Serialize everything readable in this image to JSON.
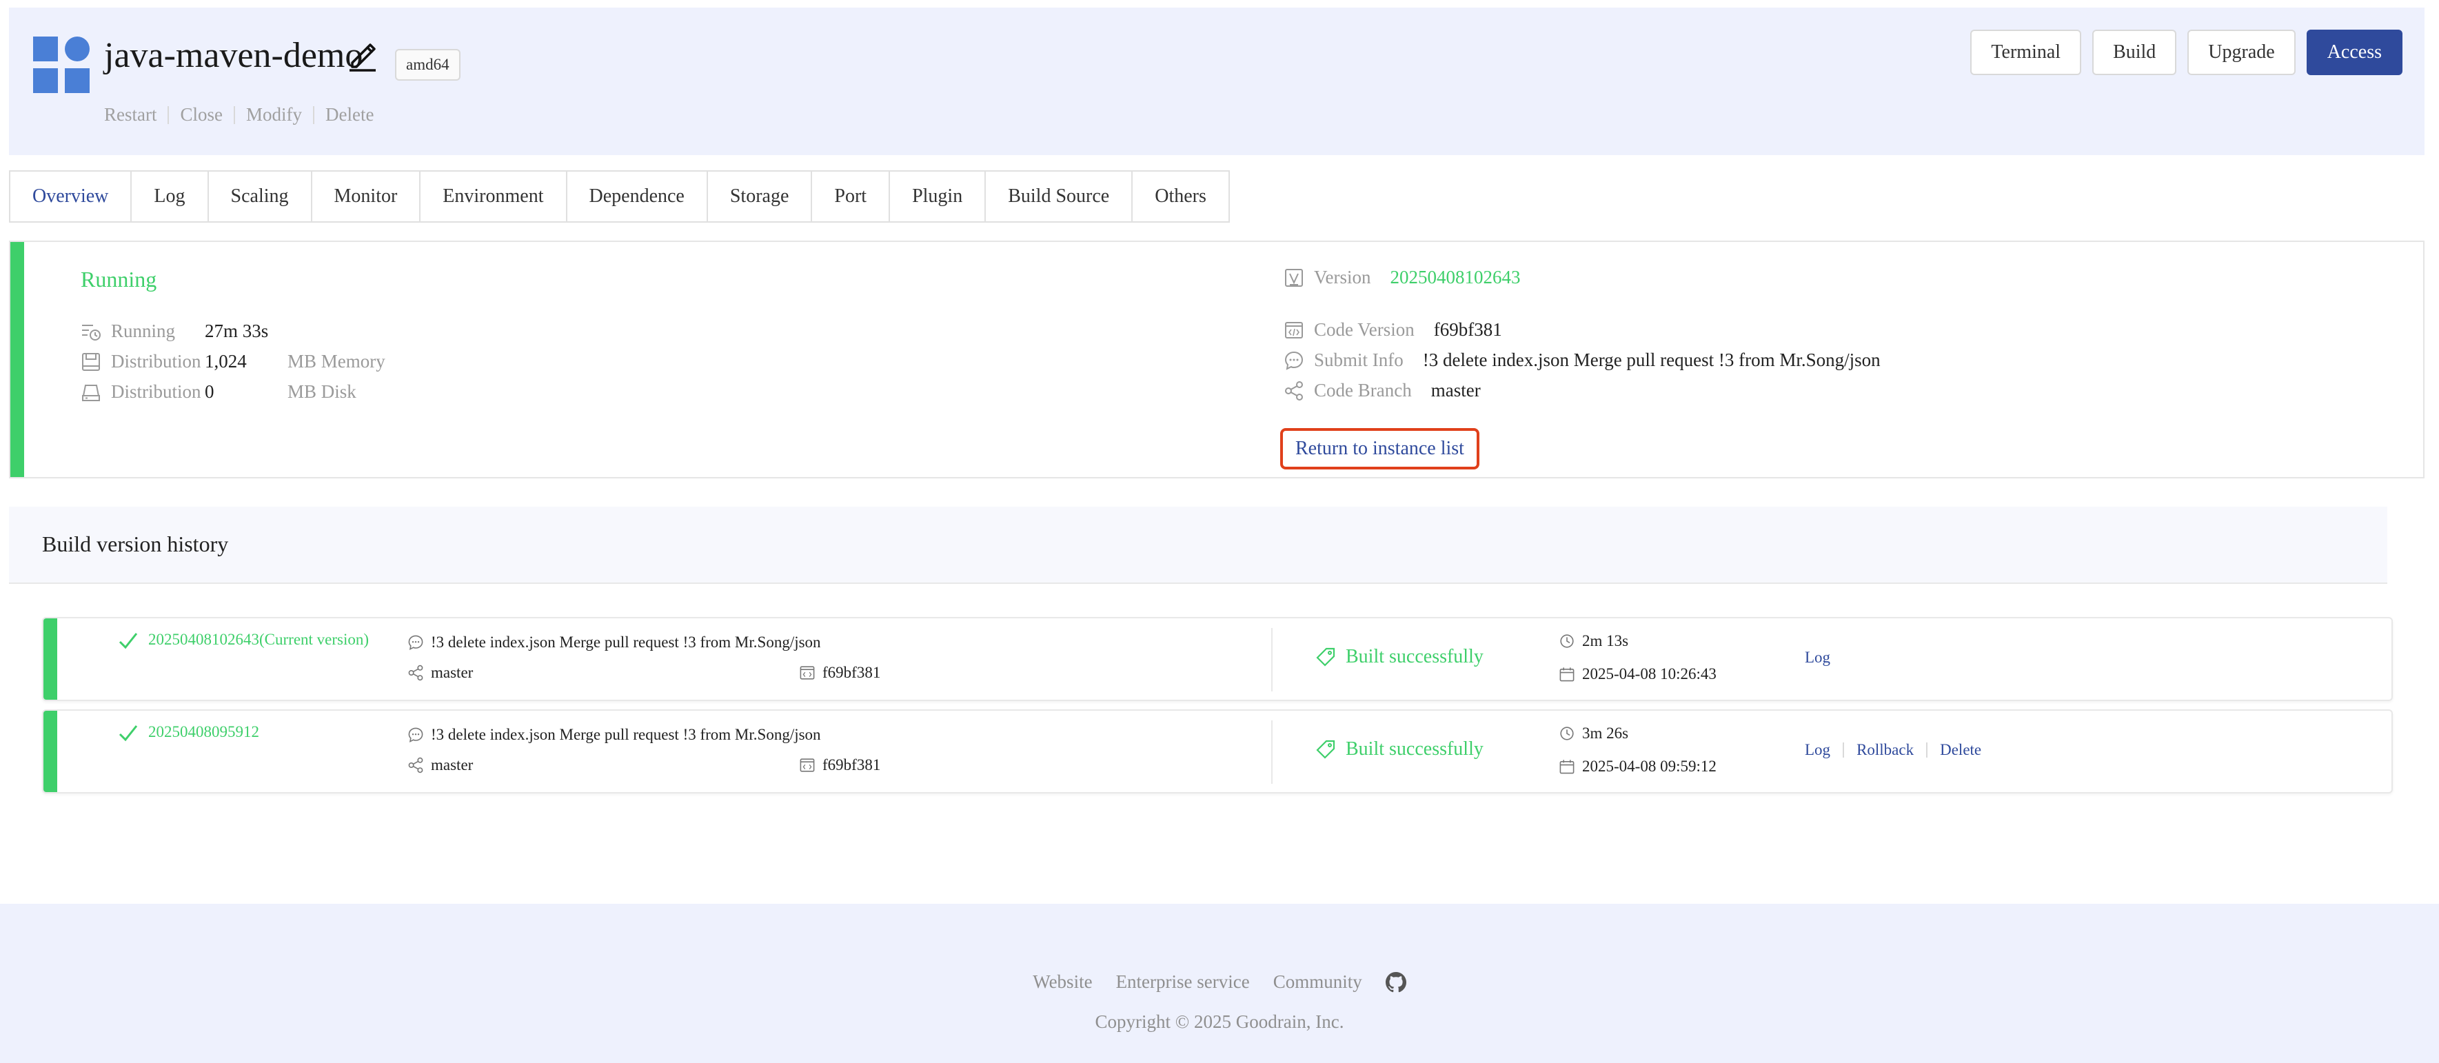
{
  "header": {
    "app_name": "java-maven-demo",
    "arch_badge": "amd64",
    "actions": [
      "Restart",
      "Close",
      "Modify",
      "Delete"
    ],
    "buttons": {
      "terminal": "Terminal",
      "build": "Build",
      "upgrade": "Upgrade",
      "access": "Access"
    },
    "accent_color": "#2f4a9c"
  },
  "tabs": [
    "Overview",
    "Log",
    "Scaling",
    "Monitor",
    "Environment",
    "Dependence",
    "Storage",
    "Port",
    "Plugin",
    "Build Source",
    "Others"
  ],
  "overview": {
    "status": "Running",
    "stats": [
      {
        "icon": "running-time-icon",
        "label": "Running",
        "value": "27m 33s",
        "unit": ""
      },
      {
        "icon": "memory-icon",
        "label": "Distribution",
        "value": "1,024",
        "unit": "MB Memory"
      },
      {
        "icon": "disk-icon",
        "label": "Distribution",
        "value": "0",
        "unit": "MB Disk"
      }
    ],
    "info": {
      "version": {
        "label": "Version",
        "value": "20250408102643"
      },
      "code_version": {
        "label": "Code Version",
        "value": "f69bf381"
      },
      "submit_info": {
        "label": "Submit Info",
        "value": "!3 delete index.json Merge pull request !3 from Mr.Song/json"
      },
      "code_branch": {
        "label": "Code Branch",
        "value": "master"
      }
    },
    "return_link": "Return to instance list",
    "status_color": "#3ecf6a"
  },
  "history": {
    "title": "Build version history",
    "builds": [
      {
        "version": "20250408102643(Current version)",
        "commit": "!3 delete index.json Merge pull request !3 from Mr.Song/json",
        "branch": "master",
        "hash": "f69bf381",
        "status": "Built successfully",
        "duration": "2m 13s",
        "date": "2025-04-08 10:26:43",
        "links": [
          "Log"
        ]
      },
      {
        "version": "20250408095912",
        "commit": "!3 delete index.json Merge pull request !3 from Mr.Song/json",
        "branch": "master",
        "hash": "f69bf381",
        "status": "Built successfully",
        "duration": "3m 26s",
        "date": "2025-04-08 09:59:12",
        "links": [
          "Log",
          "Rollback",
          "Delete"
        ]
      }
    ]
  },
  "footer": {
    "links": [
      "Website",
      "Enterprise service",
      "Community"
    ],
    "copyright_pre": "Copyright",
    "copyright_post": "2025 Goodrain, Inc."
  }
}
